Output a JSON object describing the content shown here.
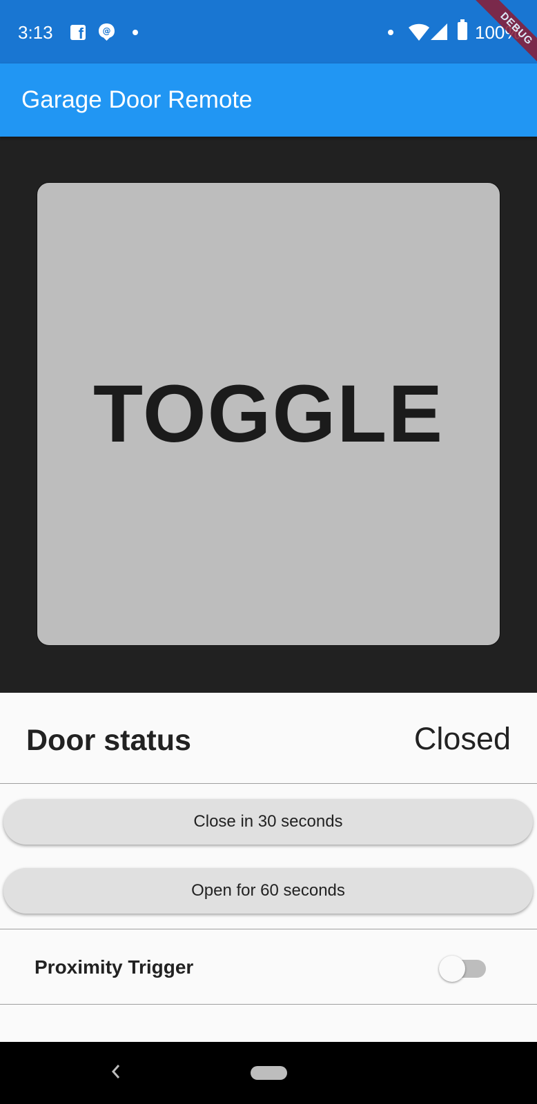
{
  "status_bar": {
    "time": "3:13",
    "battery": "100%",
    "debug_banner": "DEBUG",
    "icons": [
      "facebook-icon",
      "at-sign-icon",
      "notification-dot-icon",
      "wifi-icon",
      "signal-icon",
      "battery-icon"
    ]
  },
  "app_bar": {
    "title": "Garage Door Remote",
    "color": "#2196f3"
  },
  "toggle": {
    "label": "TOGGLE"
  },
  "door_status": {
    "label": "Door status",
    "value": "Closed"
  },
  "actions": {
    "close_label": "Close in 30 seconds",
    "open_label": "Open for 60 seconds"
  },
  "proximity": {
    "label": "Proximity Trigger",
    "enabled": false
  },
  "nav_bar": {
    "icons": [
      "back-icon",
      "home-pill-icon"
    ]
  }
}
